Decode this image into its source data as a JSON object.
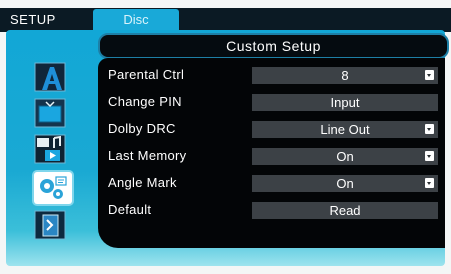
{
  "tabs": [
    {
      "label": "SETUP"
    },
    {
      "label": "Disc"
    }
  ],
  "header": {
    "title": "Custom Setup"
  },
  "sidebar": {
    "items": [
      {
        "icon": "language-icon"
      },
      {
        "icon": "display-icon"
      },
      {
        "icon": "audio-video-icon"
      },
      {
        "icon": "custom-settings-icon"
      },
      {
        "icon": "exit-icon"
      }
    ]
  },
  "rows": [
    {
      "label": "Parental Ctrl",
      "value": "8",
      "dropdown": true
    },
    {
      "label": "Change PIN",
      "value": "Input",
      "dropdown": false
    },
    {
      "label": "Dolby DRC",
      "value": "Line Out",
      "dropdown": true
    },
    {
      "label": "Last Memory",
      "value": "On",
      "dropdown": true
    },
    {
      "label": "Angle Mark",
      "value": "On",
      "dropdown": true
    },
    {
      "label": "Default",
      "value": "Read",
      "dropdown": false
    }
  ],
  "colors": {
    "panel": "#12a7d6",
    "content": "#030507",
    "value_field": "#3c4146",
    "text": "#ffffff"
  }
}
